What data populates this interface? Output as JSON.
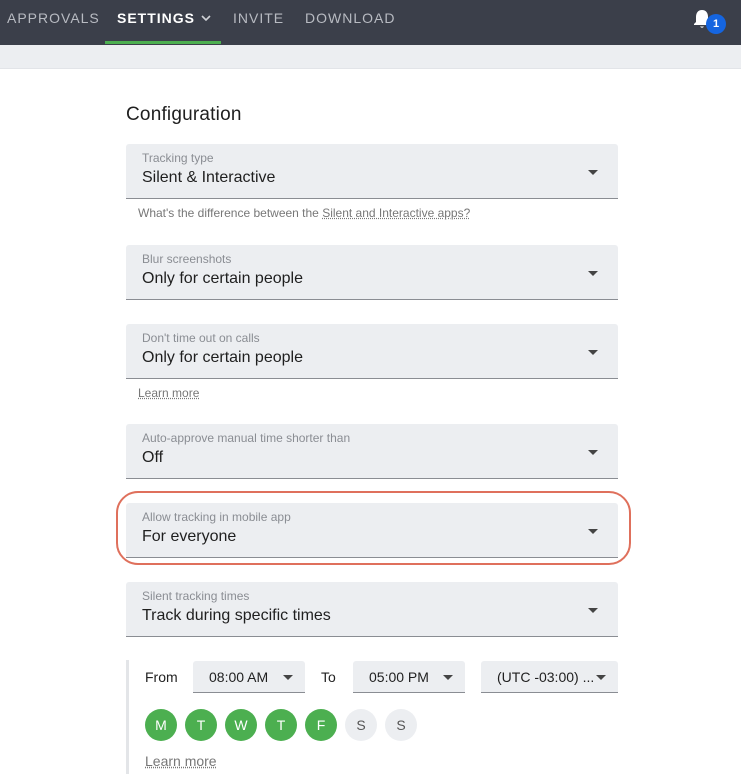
{
  "nav": {
    "tabs": [
      {
        "label": "APPROVALS"
      },
      {
        "label": "SETTINGS"
      },
      {
        "label": "INVITE"
      },
      {
        "label": "DOWNLOAD"
      }
    ],
    "notification_count": "1",
    "active_color": "#4caf50",
    "badge_color": "#1565e0"
  },
  "page": {
    "title": "Configuration"
  },
  "fields": {
    "tracking_type": {
      "label": "Tracking type",
      "value": "Silent & Interactive"
    },
    "blur_screenshots": {
      "label": "Blur screenshots",
      "value": "Only for certain people"
    },
    "calls_timeout": {
      "label": "Don't time out on calls",
      "value": "Only for certain people"
    },
    "auto_approve": {
      "label": "Auto-approve manual time shorter than",
      "value": "Off"
    },
    "mobile_tracking": {
      "label": "Allow tracking in mobile app",
      "value": "For everyone"
    },
    "silent_times": {
      "label": "Silent tracking times",
      "value": "Track during specific times"
    }
  },
  "helpers": {
    "tracking_type_prefix": "What's the difference between the ",
    "tracking_type_link": "Silent and Interactive apps?",
    "calls_learn_more": "Learn more"
  },
  "schedule": {
    "from_label": "From",
    "from_value": "08:00 AM",
    "to_label": "To",
    "to_value": "05:00 PM",
    "timezone_value": "(UTC -03:00) ...",
    "days": [
      {
        "label": "M",
        "active": true
      },
      {
        "label": "T",
        "active": true
      },
      {
        "label": "W",
        "active": true
      },
      {
        "label": "T",
        "active": true
      },
      {
        "label": "F",
        "active": true
      },
      {
        "label": "S",
        "active": false
      },
      {
        "label": "S",
        "active": false
      }
    ],
    "learn_more": "Learn more"
  }
}
